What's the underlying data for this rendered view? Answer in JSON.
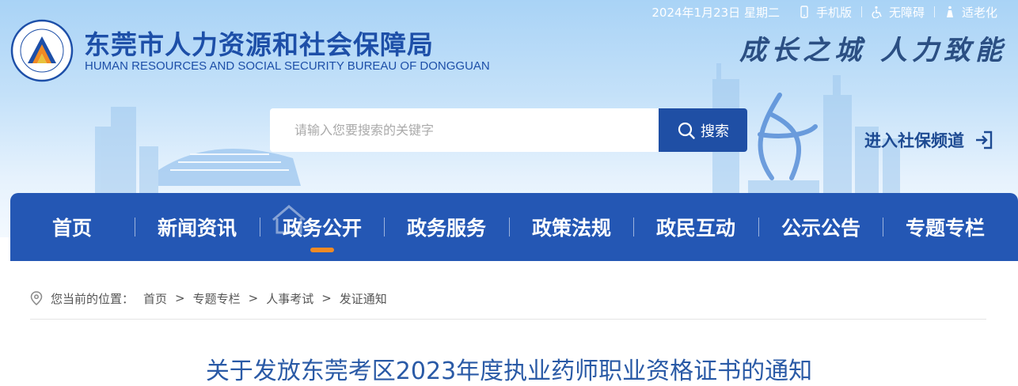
{
  "topbar": {
    "date": "2024年1月23日 星期二",
    "mobile_label": "手机版",
    "accessibility_label": "无障碍",
    "elderly_label": "适老化"
  },
  "site": {
    "title_cn": "东莞市人力资源和社会保障局",
    "title_en": "HUMAN RESOURCES AND SOCIAL SECURITY BUREAU OF DONGGUAN",
    "slogan": "成长之城  人力致能"
  },
  "search": {
    "placeholder": "请输入您要搜索的关键字",
    "button_label": "搜索"
  },
  "social_channel_label": "进入社保频道",
  "nav": {
    "tabs": [
      {
        "label": "首页"
      },
      {
        "label": "新闻资讯"
      },
      {
        "label": "政务公开"
      },
      {
        "label": "政务服务"
      },
      {
        "label": "政策法规"
      },
      {
        "label": "政民互动"
      },
      {
        "label": "公示公告"
      },
      {
        "label": "专题专栏"
      }
    ],
    "active_index": 2
  },
  "breadcrumb": {
    "prefix": "您当前的位置：",
    "items": [
      "首页",
      "专题专栏",
      "人事考试",
      "发证通知"
    ],
    "separator": ">"
  },
  "article": {
    "title": "关于发放东莞考区2023年度执业药师职业资格证书的通知"
  },
  "colors": {
    "brand_blue": "#2457b4",
    "accent_orange": "#f08a24",
    "title_blue": "#2a5aa6"
  },
  "icons": [
    "mobile-icon",
    "accessibility-icon",
    "elderly-icon",
    "search-icon",
    "enter-icon",
    "location-pin-icon",
    "bureau-emblem"
  ]
}
